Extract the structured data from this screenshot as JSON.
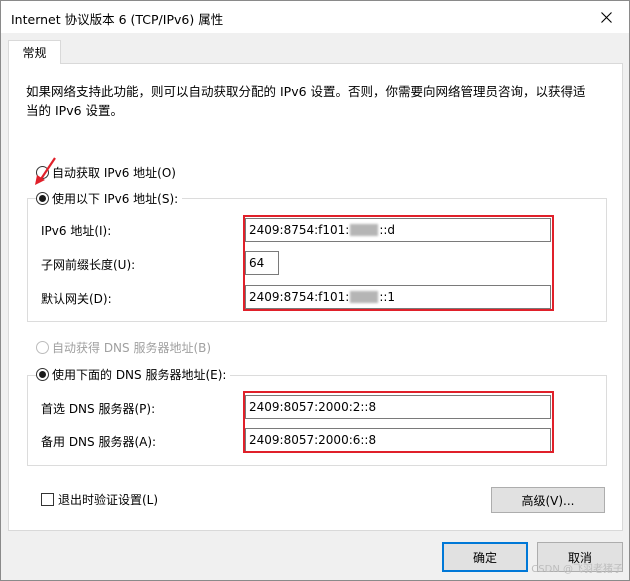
{
  "window": {
    "title": "Internet 协议版本 6 (TCP/IPv6) 属性"
  },
  "tabs": [
    {
      "label": "常规"
    }
  ],
  "description": "如果网络支持此功能，则可以自动获取分配的 IPv6 设置。否则，你需要向网络管理员咨询，以获得适当的 IPv6 设置。",
  "ip_section": {
    "auto_radio_label": "自动获取 IPv6 地址(O)",
    "manual_radio_label": "使用以下 IPv6 地址(S):",
    "auto_checked": false,
    "manual_checked": true,
    "fields": {
      "address": {
        "label": "IPv6 地址(I):",
        "prefix": "2409:8754:f101:",
        "suffix": "::d"
      },
      "prefix_length": {
        "label": "子网前缀长度(U):",
        "value": "64"
      },
      "gateway": {
        "label": "默认网关(D):",
        "prefix": "2409:8754:f101:",
        "suffix": "::1"
      }
    }
  },
  "dns_section": {
    "auto_radio_label": "自动获得 DNS 服务器地址(B)",
    "manual_radio_label": "使用下面的 DNS 服务器地址(E):",
    "fields": {
      "preferred": {
        "label": "首选 DNS 服务器(P):",
        "value": "2409:8057:2000:2::8"
      },
      "alternate": {
        "label": "备用 DNS 服务器(A):",
        "value": "2409:8057:2000:6::8"
      }
    }
  },
  "validate_checkbox_label": "退出时验证设置(L)",
  "buttons": {
    "advanced": "高级(V)...",
    "ok": "确定",
    "cancel": "取消"
  },
  "watermark": "CSDN @飞羽老猪子",
  "colors": {
    "highlight": "#e0202a",
    "default_button_border": "#0078d7"
  }
}
